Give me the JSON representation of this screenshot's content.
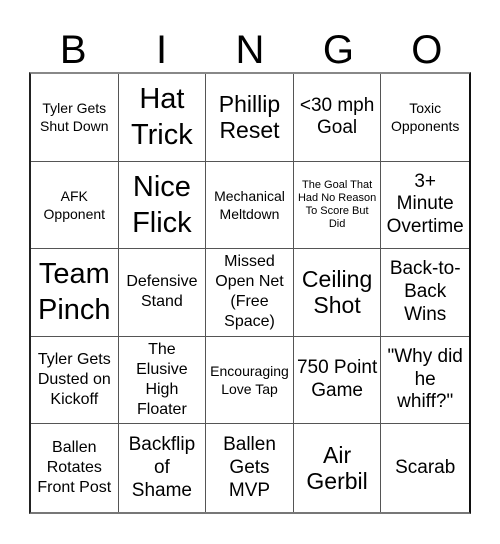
{
  "header": {
    "letters": [
      "B",
      "I",
      "N",
      "G",
      "O"
    ]
  },
  "board": {
    "rows": [
      [
        "Tyler Gets Shut Down",
        "Hat Trick",
        "Phillip Reset",
        "<30 mph Goal",
        "Toxic Opponents"
      ],
      [
        "AFK Opponent",
        "Nice Flick",
        "Mechanical Meltdown",
        "The Goal That Had No Reason To Score But Did",
        "3+ Minute Overtime"
      ],
      [
        "Team Pinch",
        "Defensive Stand",
        "Missed Open Net (Free Space)",
        "Ceiling Shot",
        "Back-to-Back Wins"
      ],
      [
        "Tyler Gets Dusted on Kickoff",
        "The Elusive High Floater",
        "Encouraging Love Tap",
        "750 Point Game",
        "\"Why did he whiff?\""
      ],
      [
        "Ballen Rotates Front Post",
        "Backflip of Shame",
        "Ballen Gets MVP",
        "Air Gerbil",
        "Scarab"
      ]
    ],
    "free_space": "Missed Open Net (Free Space)"
  },
  "colors": {
    "text": "#000000",
    "background": "#ffffff",
    "grid_line": "#555555"
  }
}
